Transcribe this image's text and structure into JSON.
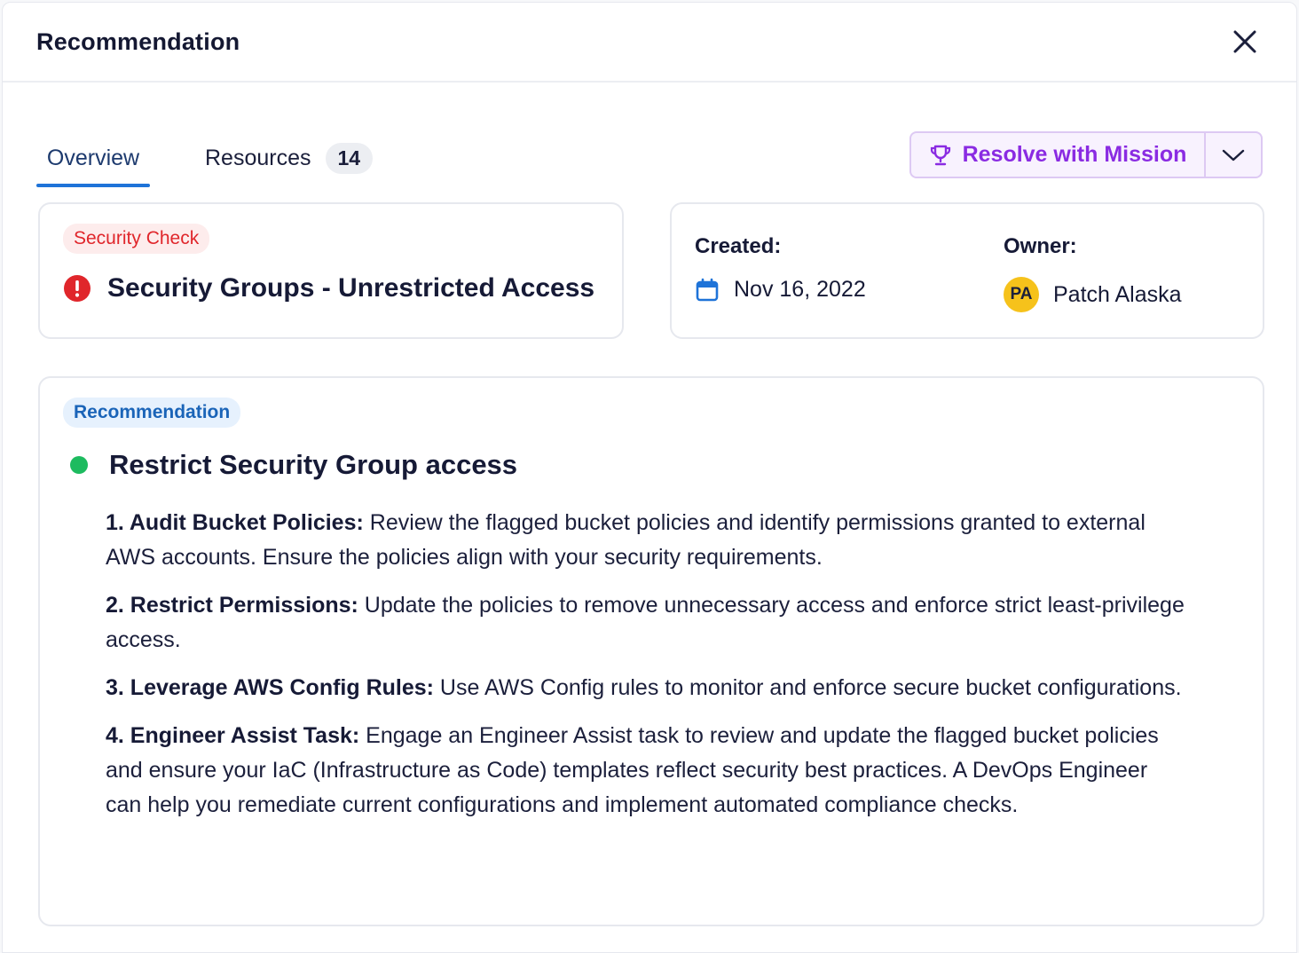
{
  "header": {
    "title": "Recommendation",
    "close_icon": "close-icon"
  },
  "tabs": [
    {
      "label": "Overview",
      "active": true
    },
    {
      "label": "Resources",
      "count": "14",
      "active": false
    }
  ],
  "actions": {
    "resolve_label": "Resolve with Mission",
    "resolve_icon": "trophy-icon",
    "dropdown_icon": "chevron-down-icon",
    "accent_color": "#8a2be2"
  },
  "check": {
    "tag": "Security Check",
    "title": "Security Groups - Unrestricted Access",
    "status_icon": "alert-circle-icon",
    "status_color": "#e0262b"
  },
  "meta": {
    "created_label": "Created:",
    "created_value": "Nov 16, 2022",
    "created_icon": "calendar-icon",
    "owner_label": "Owner:",
    "owner_initials": "PA",
    "owner_name": "Patch Alaska"
  },
  "recommendation": {
    "tag": "Recommendation",
    "title": "Restrict Security Group access",
    "status_color": "#1dbb5f",
    "steps": [
      {
        "label": "1. Audit Bucket Policies:",
        "text": " Review the flagged bucket policies and identify permissions granted to external AWS accounts. Ensure the policies align with your security requirements."
      },
      {
        "label": "2. Restrict Permissions:",
        "text": " Update the policies to remove unnecessary access and enforce strict least-privilege access."
      },
      {
        "label": "3. Leverage AWS Config Rules:",
        "text": " Use AWS Config rules to monitor and enforce secure bucket configurations."
      },
      {
        "label": "4. Engineer Assist Task:",
        "text": " Engage an Engineer Assist task to review and update the flagged bucket policies and ensure your IaC (Infrastructure as Code) templates reflect security best practices. A DevOps Engineer can help you remediate current configurations and implement automated compliance checks."
      }
    ]
  }
}
